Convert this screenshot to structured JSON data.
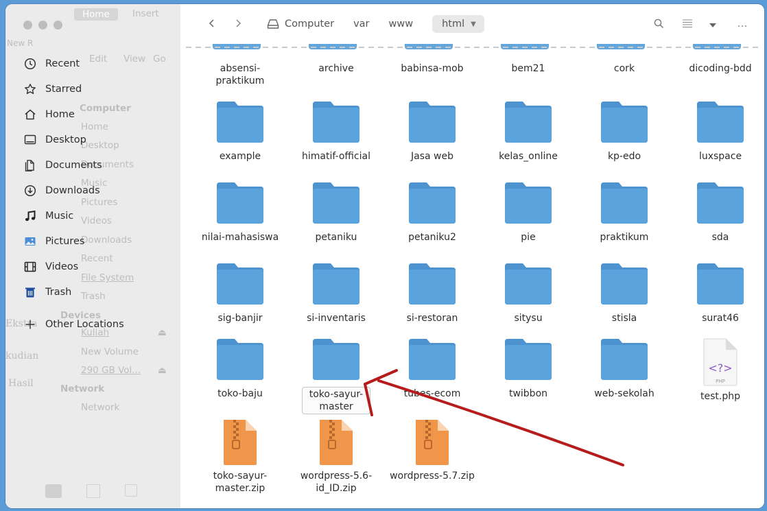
{
  "window": {
    "accent": "#5b9bd8",
    "folder_color": "#5aa3dc",
    "zip_color": "#f0964a"
  },
  "ghost_text": {
    "home_tab": "Home",
    "insert_tab": "Insert",
    "new_label": "New R",
    "edit": "Edit",
    "view": "View",
    "go": "Go",
    "computer": "Computer",
    "home": "Home",
    "desktop": "Desktop",
    "documents": "Documents",
    "music": "Music",
    "pictures": "Pictures",
    "videos": "Videos",
    "downloads": "Downloads",
    "recent": "Recent",
    "file_system": "File System",
    "trash": "Trash",
    "devices": "Devices",
    "kuliah": "Kuliah",
    "new_volume": "New Volume",
    "volume_290": "290 GB Vol...",
    "network_header": "Network",
    "network": "Network",
    "side_ekstra": "Ekstra",
    "side_kudian": "kudian",
    "side_hasil": "Hasil"
  },
  "sidebar": {
    "items": [
      {
        "label": "Recent",
        "icon": "clock-icon"
      },
      {
        "label": "Starred",
        "icon": "star-icon"
      },
      {
        "label": "Home",
        "icon": "home-icon"
      },
      {
        "label": "Desktop",
        "icon": "desktop-icon"
      },
      {
        "label": "Documents",
        "icon": "documents-icon"
      },
      {
        "label": "Downloads",
        "icon": "download-icon"
      },
      {
        "label": "Music",
        "icon": "music-icon"
      },
      {
        "label": "Pictures",
        "icon": "pictures-icon"
      },
      {
        "label": "Videos",
        "icon": "videos-icon"
      },
      {
        "label": "Trash",
        "icon": "trash-icon"
      },
      {
        "label": "Other Locations",
        "icon": "plus-icon"
      }
    ]
  },
  "header": {
    "breadcrumbs": [
      "Computer",
      "var",
      "www",
      "html"
    ],
    "icons": [
      "back-icon",
      "forward-icon",
      "search-icon",
      "list-view-icon",
      "view-options-icon",
      "more-icon"
    ]
  },
  "files": [
    {
      "name": "absensi-praktikum",
      "type": "folder"
    },
    {
      "name": "archive",
      "type": "folder"
    },
    {
      "name": "babinsa-mob",
      "type": "folder"
    },
    {
      "name": "bem21",
      "type": "folder"
    },
    {
      "name": "cork",
      "type": "folder"
    },
    {
      "name": "dicoding-bdd",
      "type": "folder"
    },
    {
      "name": "example",
      "type": "folder"
    },
    {
      "name": "himatif-official",
      "type": "folder"
    },
    {
      "name": "Jasa web",
      "type": "folder"
    },
    {
      "name": "kelas_online",
      "type": "folder"
    },
    {
      "name": "kp-edo",
      "type": "folder"
    },
    {
      "name": "luxspace",
      "type": "folder"
    },
    {
      "name": "nilai-mahasiswa",
      "type": "folder"
    },
    {
      "name": "petaniku",
      "type": "folder"
    },
    {
      "name": "petaniku2",
      "type": "folder"
    },
    {
      "name": "pie",
      "type": "folder"
    },
    {
      "name": "praktikum",
      "type": "folder"
    },
    {
      "name": "sda",
      "type": "folder"
    },
    {
      "name": "sig-banjir",
      "type": "folder"
    },
    {
      "name": "si-inventaris",
      "type": "folder"
    },
    {
      "name": "si-restoran",
      "type": "folder"
    },
    {
      "name": "sitysu",
      "type": "folder"
    },
    {
      "name": "stisla",
      "type": "folder"
    },
    {
      "name": "surat46",
      "type": "folder"
    },
    {
      "name": "toko-baju",
      "type": "folder"
    },
    {
      "name": "toko-sayur-master",
      "type": "folder",
      "selected": true
    },
    {
      "name": "tubes-ecom",
      "type": "folder"
    },
    {
      "name": "twibbon",
      "type": "folder"
    },
    {
      "name": "web-sekolah",
      "type": "folder"
    },
    {
      "name": "test.php",
      "type": "php",
      "badge": "PHP",
      "glyph": "<?>"
    },
    {
      "name": "toko-sayur-master.zip",
      "type": "zip"
    },
    {
      "name": "wordpress-5.6-id_ID.zip",
      "type": "zip"
    },
    {
      "name": "wordpress-5.7.zip",
      "type": "zip"
    }
  ]
}
